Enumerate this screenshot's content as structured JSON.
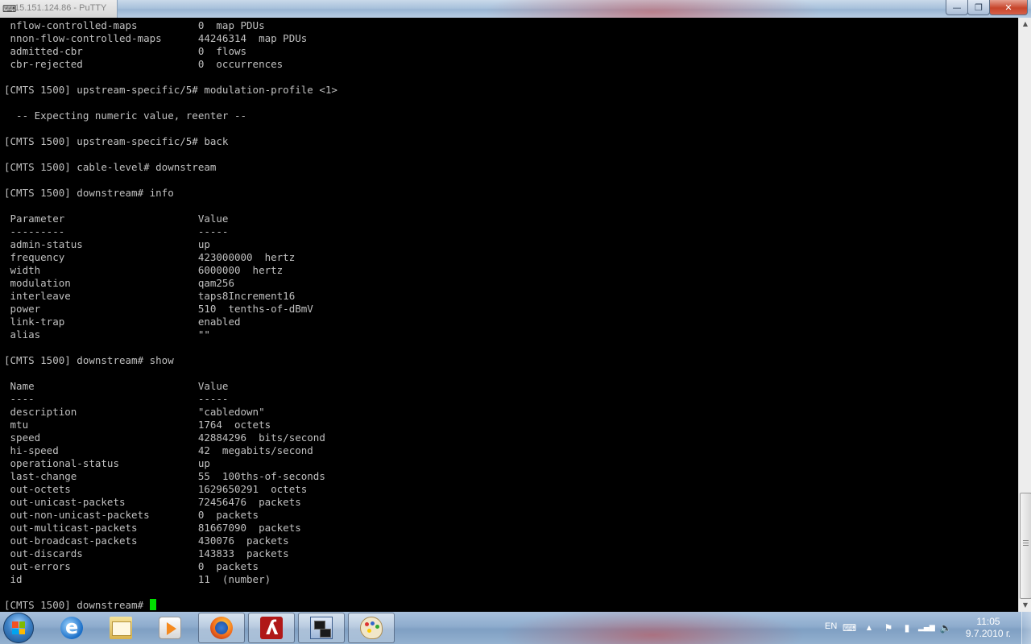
{
  "window": {
    "title": "15.151.124.86 - PuTTY",
    "buttons": {
      "minimize": "—",
      "maximize": "❐",
      "close": "✕"
    }
  },
  "terminal": {
    "lines": [
      " nflow-controlled-maps          0  map PDUs",
      " nnon-flow-controlled-maps      44246314  map PDUs",
      " admitted-cbr                   0  flows",
      " cbr-rejected                   0  occurrences",
      "",
      "[CMTS 1500] upstream-specific/5# modulation-profile <1>",
      "",
      "  -- Expecting numeric value, reenter --",
      "",
      "[CMTS 1500] upstream-specific/5# back",
      "",
      "[CMTS 1500] cable-level# downstream",
      "",
      "[CMTS 1500] downstream# info",
      "",
      " Parameter                      Value",
      " ---------                      -----",
      " admin-status                   up",
      " frequency                      423000000  hertz",
      " width                          6000000  hertz",
      " modulation                     qam256",
      " interleave                     taps8Increment16",
      " power                          510  tenths-of-dBmV",
      " link-trap                      enabled",
      " alias                          \"\"",
      "",
      "[CMTS 1500] downstream# show",
      "",
      " Name                           Value",
      " ----                           -----",
      " description                    \"cabledown\"",
      " mtu                            1764  octets",
      " speed                          42884296  bits/second",
      " hi-speed                       42  megabits/second",
      " operational-status             up",
      " last-change                    55  100ths-of-seconds",
      " out-octets                     1629650291  octets",
      " out-unicast-packets            72456476  packets",
      " out-non-unicast-packets        0  packets",
      " out-multicast-packets          81667090  packets",
      " out-broadcast-packets          430076  packets",
      " out-discards                   143833  packets",
      " out-errors                     0  packets",
      " id                             11  (number)",
      ""
    ],
    "prompt": "[CMTS 1500] downstream# ",
    "cursor_color": "#00e000"
  },
  "scrollbar": {
    "up": "▲",
    "down": "▼"
  },
  "taskbar": {
    "items": [
      {
        "name": "internet-explorer",
        "icon": "ie-icon",
        "active": false
      },
      {
        "name": "windows-explorer",
        "icon": "folder-icon",
        "active": false
      },
      {
        "name": "media-player",
        "icon": "media-icon",
        "active": false
      },
      {
        "name": "firefox",
        "icon": "firefox-icon",
        "active": true
      },
      {
        "name": "adobe-reader",
        "icon": "pdf-icon",
        "active": true
      },
      {
        "name": "putty",
        "icon": "putty-icon",
        "active": true
      },
      {
        "name": "paint",
        "icon": "paint-icon",
        "active": true
      }
    ],
    "tray": {
      "language": "EN",
      "keyboard_icon": "⌨",
      "show_hidden": "▲",
      "flag_icon": "⚑",
      "network_icon": "▮",
      "signal_icon": "▂▄▆",
      "volume_icon": "🔈"
    },
    "clock": {
      "time": "11:05",
      "date": "9.7.2010 г."
    }
  }
}
